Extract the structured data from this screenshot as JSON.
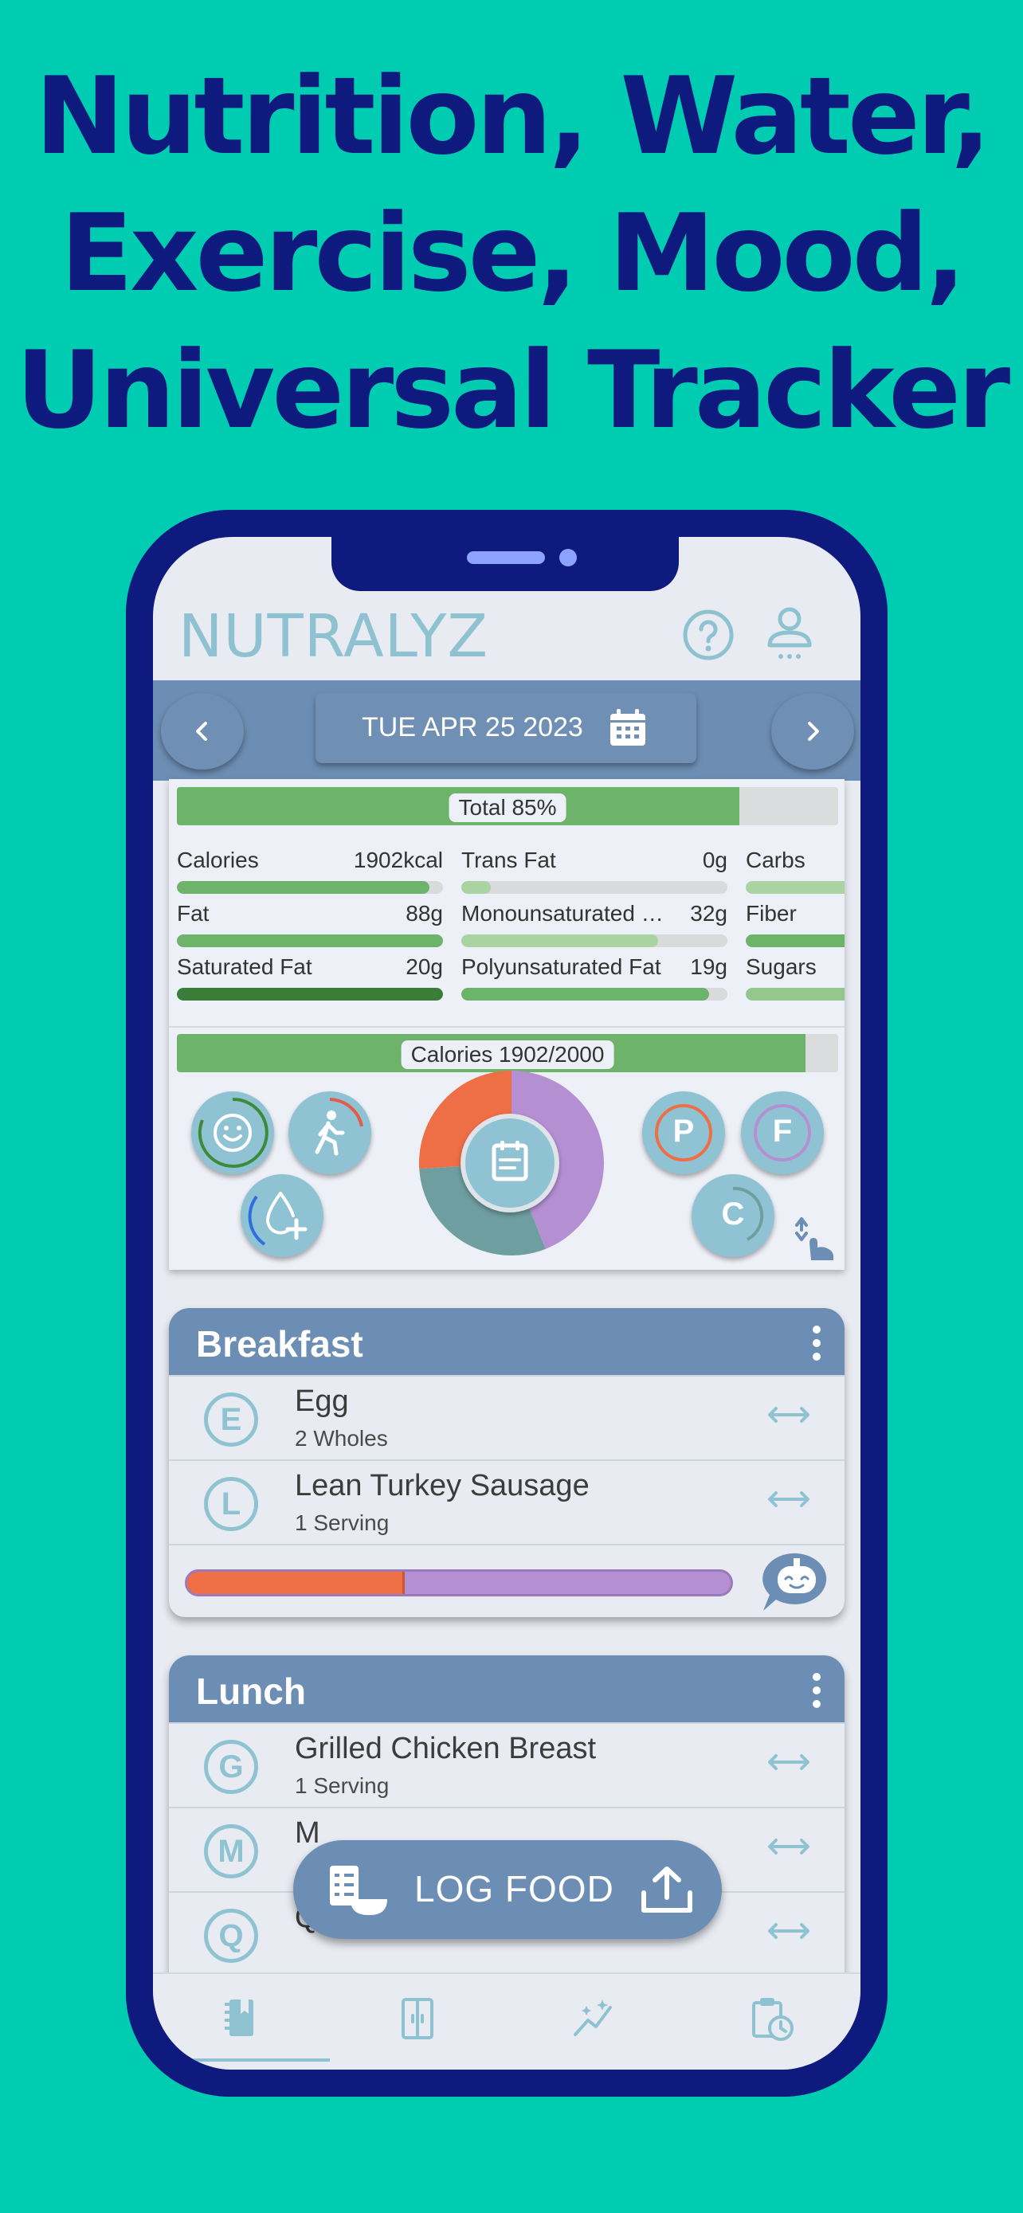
{
  "headline": [
    "Nutrition, Water,",
    "Exercise, Mood,",
    "Universal Tracker"
  ],
  "app": {
    "logo": "NUTRALYZ"
  },
  "date_bar": {
    "date": "TUE APR 25 2023"
  },
  "summary": {
    "total_label": "Total 85%",
    "total_fraction": 0.85,
    "nutrients": [
      {
        "name": "Calories",
        "value": "1902kcal",
        "fraction": 0.95
      },
      {
        "name": "Trans Fat",
        "value": "0g",
        "fraction": 0.11
      },
      {
        "name": "Carbs",
        "value": "",
        "fraction": 1.0
      },
      {
        "name": "Fat",
        "value": "88g",
        "fraction": 1.0
      },
      {
        "name": "Monounsaturated …",
        "value": "32g",
        "fraction": 0.74
      },
      {
        "name": "Fiber",
        "value": "",
        "fraction": 1.0
      },
      {
        "name": "Saturated Fat",
        "value": "20g",
        "fraction": 1.0
      },
      {
        "name": "Polyunsaturated Fat",
        "value": "19g",
        "fraction": 0.93
      },
      {
        "name": "Sugars",
        "value": "",
        "fraction": 1.0
      }
    ],
    "calories_label": "Calories 1902/2000",
    "calories_fraction": 0.951
  },
  "pie": {
    "slices": [
      {
        "name": "carbs",
        "value": 44,
        "color": "#b48fd2"
      },
      {
        "name": "protein",
        "value": 30,
        "color": "#6f9ea0"
      },
      {
        "name": "fat",
        "value": 26,
        "color": "#ee6e45"
      }
    ]
  },
  "quick_buttons": {
    "protein": "P",
    "fat": "F",
    "carbs": "C"
  },
  "breakfast": {
    "title": "Breakfast",
    "items": [
      {
        "letter": "E",
        "name": "Egg",
        "qty": "2 Wholes"
      },
      {
        "letter": "L",
        "name": "Lean Turkey Sausage",
        "qty": "1 Serving"
      }
    ],
    "macro_fraction": 0.4
  },
  "lunch": {
    "title": "Lunch",
    "items": [
      {
        "letter": "G",
        "name": "Grilled Chicken Breast",
        "qty": "1 Serving"
      },
      {
        "letter": "M",
        "name": "M",
        "qty": ""
      },
      {
        "letter": "Q",
        "name": "Quinoa",
        "qty": ""
      }
    ]
  },
  "log_food": {
    "label": "LOG FOOD"
  },
  "colors": {
    "background": "#00ccb1",
    "brand": "#0e1a7e",
    "accent": "#6d8eb4",
    "teal": "#8fc3d3",
    "green": "#6db36a"
  }
}
